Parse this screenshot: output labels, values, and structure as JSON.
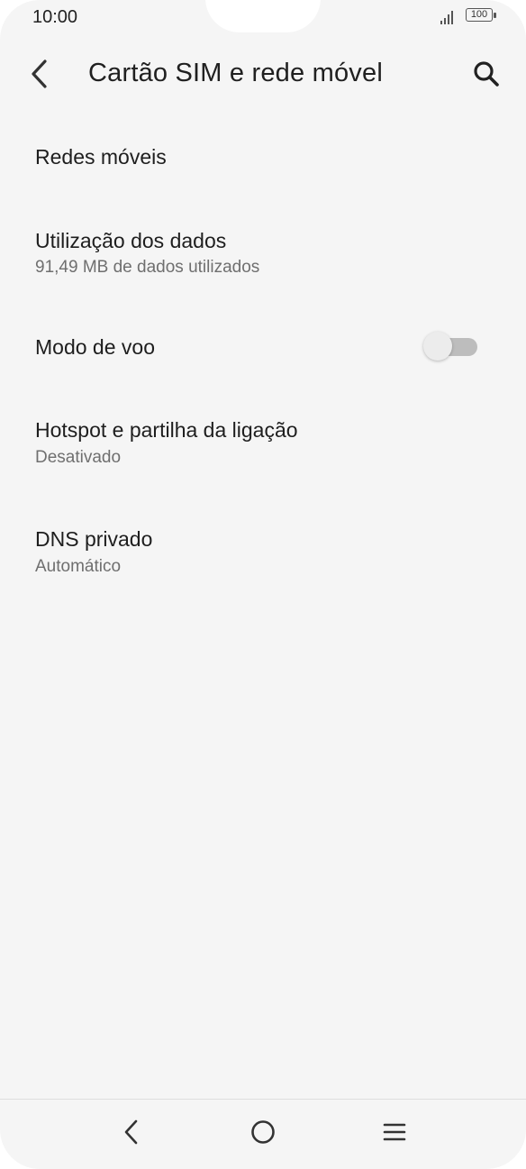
{
  "status_bar": {
    "time": "10:00",
    "battery": "100"
  },
  "header": {
    "title": "Cartão SIM e rede móvel",
    "back_icon": "back-arrow-icon",
    "search_icon": "search-icon"
  },
  "settings": {
    "items": [
      {
        "title": "Redes móveis"
      },
      {
        "title": "Utilização dos dados",
        "subtitle": "91,49 MB de dados utilizados"
      },
      {
        "title": "Modo de voo",
        "toggle": false
      },
      {
        "title": "Hotspot e partilha da ligação",
        "subtitle": "Desativado"
      },
      {
        "title": "DNS privado",
        "subtitle": "Automático"
      }
    ]
  },
  "nav_bar": {
    "icons": [
      "back-icon",
      "home-icon",
      "menu-icon"
    ]
  },
  "colors": {
    "background": "#f5f5f5",
    "text_primary": "#1e1e1e",
    "text_secondary": "#6f6f6f",
    "toggle_track_off": "#bdbdbd",
    "toggle_thumb_off": "#ececec"
  }
}
